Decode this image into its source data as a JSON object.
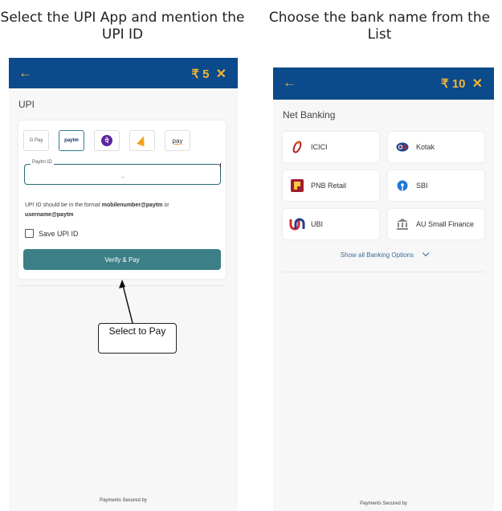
{
  "captions": {
    "left": "Select the UPI App and mention the UPI ID",
    "right": "Choose the bank name from the List"
  },
  "left_screen": {
    "header": {
      "back_icon": "←",
      "amount": "₹ 5",
      "close_icon": "✕"
    },
    "section_title": "UPI",
    "upi_apps": [
      {
        "name": "gpay",
        "label": "G Pay",
        "selected": false
      },
      {
        "name": "paytm",
        "label": "paytm",
        "selected": true
      },
      {
        "name": "phonepe",
        "label": "पे",
        "selected": false
      },
      {
        "name": "google-play-triangle",
        "label": "",
        "selected": false
      },
      {
        "name": "amazon-pay",
        "label": "pay",
        "selected": false
      }
    ],
    "upi_id_field": {
      "label": "Paytm ID",
      "value": "→"
    },
    "hint": {
      "prefix": "UPI ID should be in the format ",
      "format1": "mobilenumber@paytm",
      "middle": " or ",
      "format2": "username@paytm"
    },
    "save_upi_label": "Save UPI ID",
    "verify_button": "Verify & Pay",
    "footer": "Payments Secured by",
    "callout": "Select to Pay"
  },
  "right_screen": {
    "header": {
      "back_icon": "←",
      "amount": "₹ 10",
      "close_icon": "✕"
    },
    "section_title": "Net Banking",
    "banks": [
      {
        "label": "ICICI",
        "icon": "icici-icon",
        "color": "#b22222"
      },
      {
        "label": "Kotak",
        "icon": "kotak-icon",
        "color": "#1d3f8a"
      },
      {
        "label": "PNB Retail",
        "icon": "pnb-icon",
        "color": "#a11c2e"
      },
      {
        "label": "SBI",
        "icon": "sbi-icon",
        "color": "#1f7ad6"
      },
      {
        "label": "UBI",
        "icon": "ubi-icon",
        "color": "#d7282f"
      },
      {
        "label": "AU Small Finance",
        "icon": "bank-building-icon",
        "color": "#777777"
      }
    ],
    "show_all": "Show all Banking Options",
    "footer": "Payments Secured by"
  },
  "colors": {
    "header_bg": "#0b4a8b",
    "header_text": "#f2b43a",
    "verify_button": "#3c7f87"
  }
}
